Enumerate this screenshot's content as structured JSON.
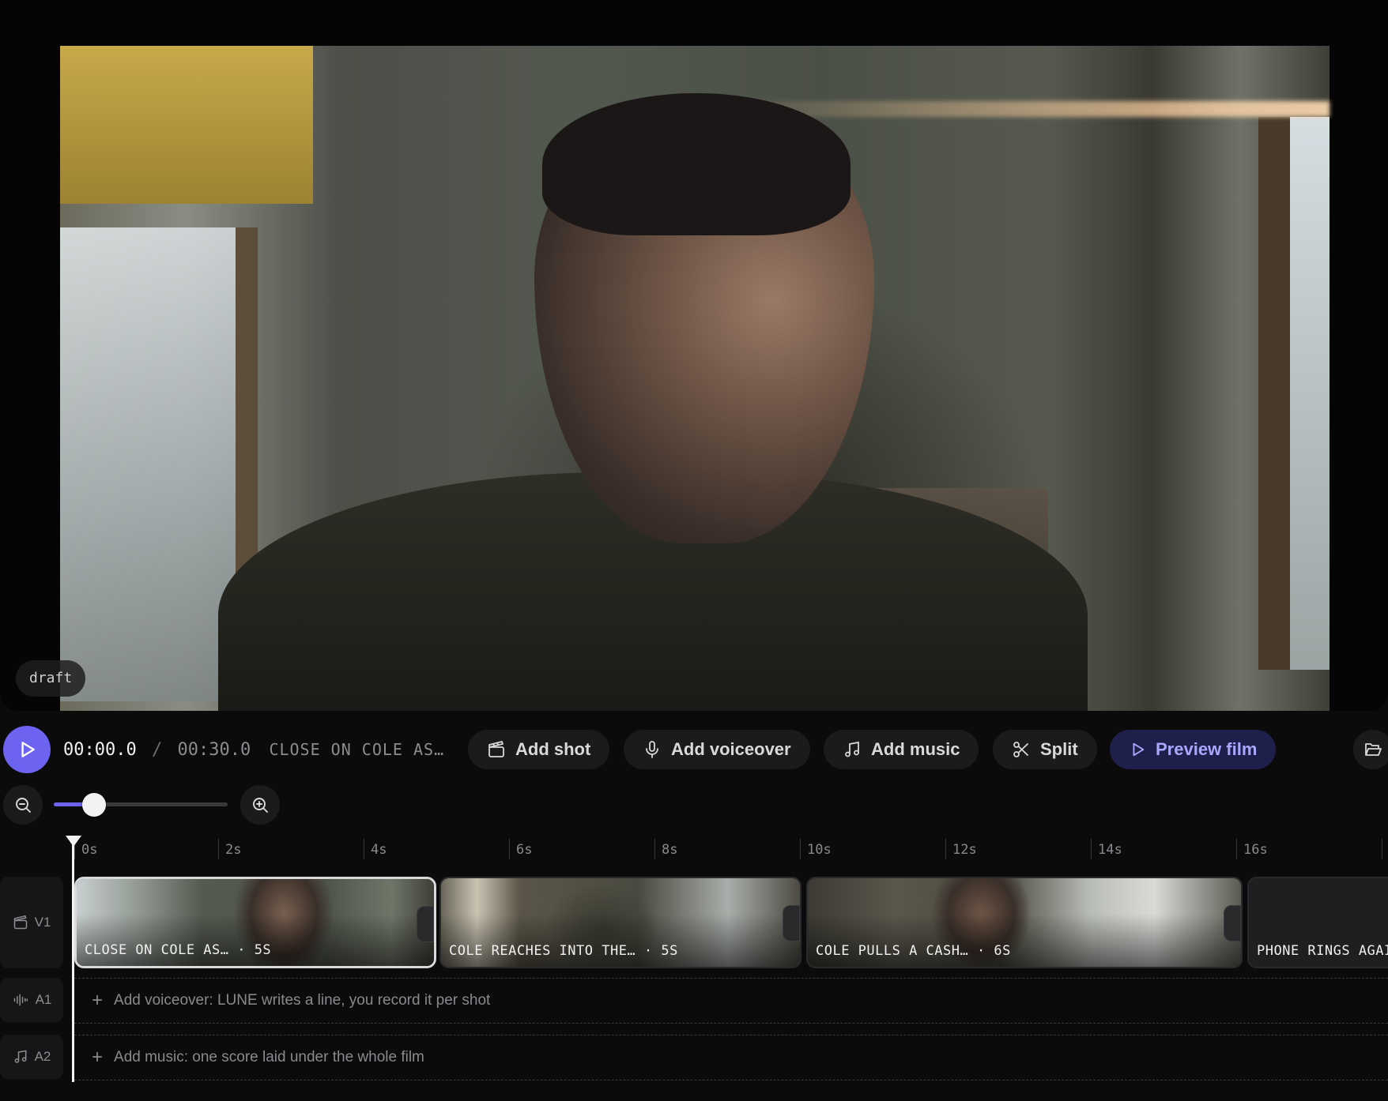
{
  "preview": {
    "badge": "draft"
  },
  "transport": {
    "current_time": "00:00.0",
    "separator": "/",
    "total_time": "00:30.0",
    "current_shot": "CLOSE ON COLE AS…"
  },
  "toolbar": {
    "add_shot": "Add shot",
    "add_voiceover": "Add voiceover",
    "add_music": "Add music",
    "split": "Split",
    "preview_film": "Preview film"
  },
  "zoom": {
    "level_fraction": 0.23
  },
  "ruler": {
    "ticks": [
      "0s",
      "2s",
      "4s",
      "6s",
      "8s",
      "10s",
      "12s",
      "14s",
      "16s"
    ]
  },
  "tracks": {
    "v1": {
      "label": "V1",
      "clips": [
        {
          "label": "CLOSE ON COLE AS… · 5S",
          "selected": true
        },
        {
          "label": "COLE REACHES INTO THE… · 5S",
          "selected": false
        },
        {
          "label": "COLE PULLS A CASH… · 6S",
          "selected": false
        },
        {
          "label": "PHONE RINGS AGAI",
          "selected": false
        }
      ]
    },
    "a1": {
      "label": "A1",
      "placeholder": "Add voiceover: LUNE writes a line, you record it per shot"
    },
    "a2": {
      "label": "A2",
      "placeholder": "Add music: one score laid under the whole film"
    }
  },
  "colors": {
    "accent": "#6c63f0",
    "primary_button_bg": "#1e1f4a",
    "primary_button_text": "#a9a8ff",
    "background": "#0b0b0c"
  },
  "icons": {
    "play": "play-icon",
    "add_shot": "clapperboard-icon",
    "add_voiceover": "microphone-icon",
    "add_music": "music-note-icon",
    "split": "scissors-icon",
    "preview_film": "play-outline-icon",
    "folder": "folder-open-icon",
    "zoom_out": "zoom-out-icon",
    "zoom_in": "zoom-in-icon",
    "v1": "clapperboard-icon",
    "a1": "waveform-icon",
    "a2": "music-note-icon"
  }
}
